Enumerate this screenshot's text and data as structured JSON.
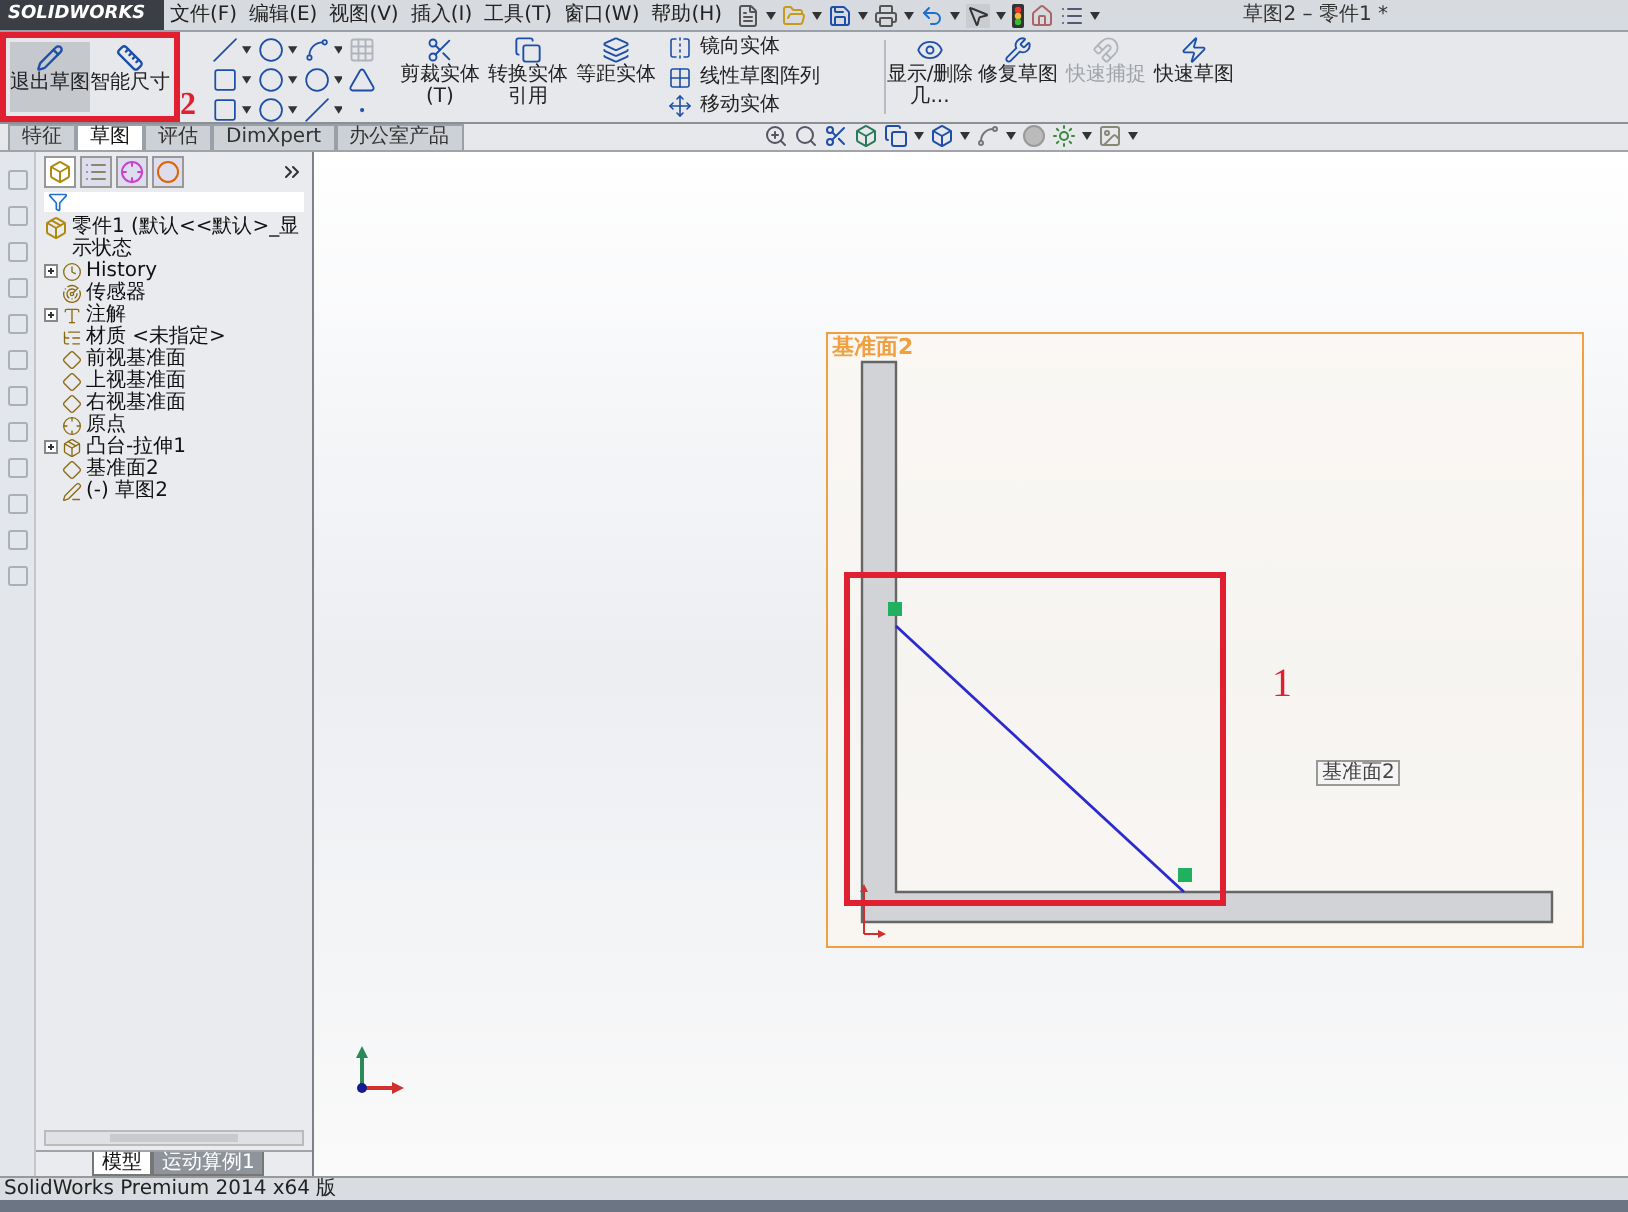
{
  "window": {
    "title": "草图2 – 零件1 *"
  },
  "logo": "SOLIDWORKS",
  "menu": [
    "文件(F)",
    "编辑(E)",
    "视图(V)",
    "插入(I)",
    "工具(T)",
    "窗口(W)",
    "帮助(H)"
  ],
  "sketch_commands": {
    "main": [
      {
        "label": "退出草图",
        "active": true
      },
      {
        "label": "智能尺寸",
        "active": false
      }
    ],
    "edit": [
      {
        "label": "剪裁实体(T)"
      },
      {
        "label": "转换实体引用"
      },
      {
        "label": "等距实体"
      }
    ],
    "small": [
      {
        "label": "镜向实体"
      },
      {
        "label": "线性草图阵列"
      },
      {
        "label": "移动实体"
      }
    ],
    "display": [
      {
        "label": "显示/删除几...",
        "disabled": false
      },
      {
        "label": "修复草图",
        "disabled": false
      },
      {
        "label": "快速捕捉",
        "disabled": true
      },
      {
        "label": "快速草图",
        "disabled": false
      }
    ]
  },
  "tabs": [
    {
      "label": "特征",
      "selected": false
    },
    {
      "label": "草图",
      "selected": true
    },
    {
      "label": "评估",
      "selected": false
    },
    {
      "label": "DimXpert",
      "selected": false
    },
    {
      "label": "办公室产品",
      "selected": false
    }
  ],
  "tree": {
    "root": "零件1 (默认<<默认>_显示状态",
    "items": [
      {
        "label": "History",
        "expandable": true
      },
      {
        "label": "传感器",
        "expandable": false
      },
      {
        "label": "注解",
        "expandable": true
      },
      {
        "label": "材质 <未指定>",
        "expandable": false
      },
      {
        "label": "前视基准面",
        "expandable": false
      },
      {
        "label": "上视基准面",
        "expandable": false
      },
      {
        "label": "右视基准面",
        "expandable": false
      },
      {
        "label": "原点",
        "expandable": false
      },
      {
        "label": "凸台-拉伸1",
        "expandable": true
      },
      {
        "label": "基准面2",
        "expandable": false
      },
      {
        "label": "(-) 草图2",
        "expandable": false
      }
    ]
  },
  "canvas": {
    "plane_label": "基准面2",
    "plane_tag": "基准面2"
  },
  "annotations": [
    {
      "label": "1"
    },
    {
      "label": "2"
    }
  ],
  "bottom_tabs": [
    {
      "label": "模型",
      "selected": true
    },
    {
      "label": "运动算例1",
      "selected": false
    }
  ],
  "status_bar": "SolidWorks Premium 2014 x64 版"
}
